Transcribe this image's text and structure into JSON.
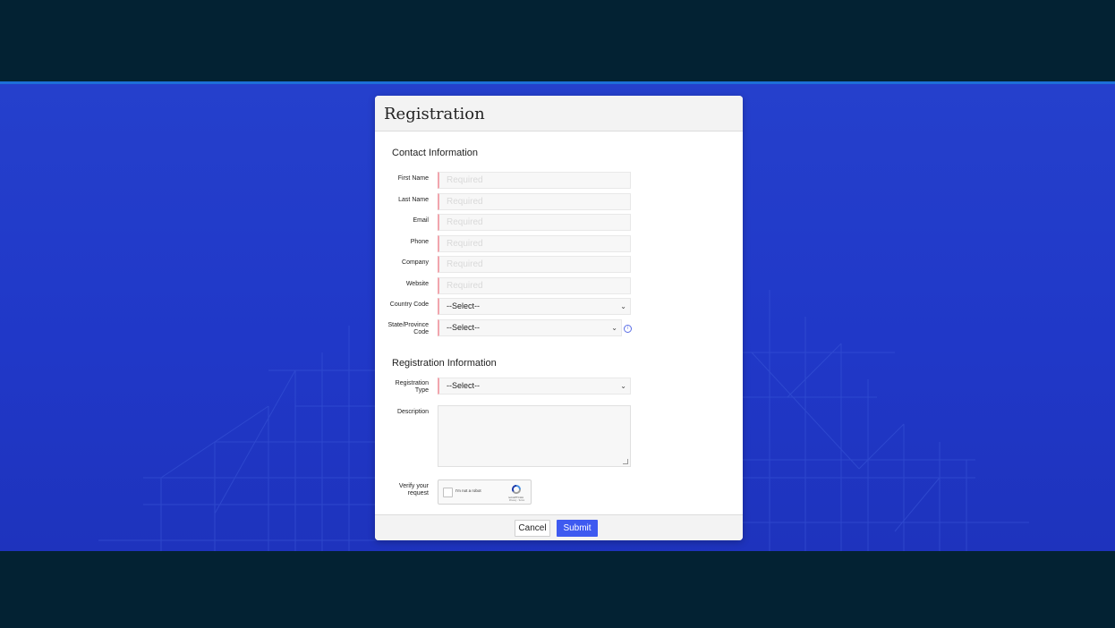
{
  "dialog": {
    "title": "Registration",
    "contact_section": "Contact Information",
    "registration_section": "Registration Information",
    "fields": [
      {
        "label": "First Name",
        "placeholder": "Required"
      },
      {
        "label": "Last Name",
        "placeholder": "Required"
      },
      {
        "label": "Email",
        "placeholder": "Required"
      },
      {
        "label": "Phone",
        "placeholder": "Required"
      },
      {
        "label": "Company",
        "placeholder": "Required"
      },
      {
        "label": "Website",
        "placeholder": "Required"
      }
    ],
    "country_code": {
      "label": "Country Code",
      "value": "--Select--"
    },
    "state_code": {
      "label_line1": "State/Province",
      "label_line2": "Code",
      "value": "--Select--"
    },
    "registration_type": {
      "label_line1": "Registration",
      "label_line2": "Type",
      "value": "--Select--"
    },
    "description": {
      "label": "Description"
    },
    "verify": {
      "label_line1": "Verify your",
      "label_line2": "request"
    },
    "recaptcha": {
      "label": "I'm not a robot",
      "brand": "reCAPTCHA",
      "sub": "Privacy - Terms"
    },
    "buttons": {
      "cancel": "Cancel",
      "submit": "Submit"
    }
  },
  "colors": {
    "header_bg": "#032233",
    "hero_bg": "#2038c8",
    "accent": "#1d6fd8",
    "required_marker": "#f1a5ad",
    "submit_bg": "#3e5af0"
  },
  "icons": [
    "chevron-down-icon",
    "info-icon",
    "recaptcha-logo-icon",
    "resize-handle-icon"
  ]
}
